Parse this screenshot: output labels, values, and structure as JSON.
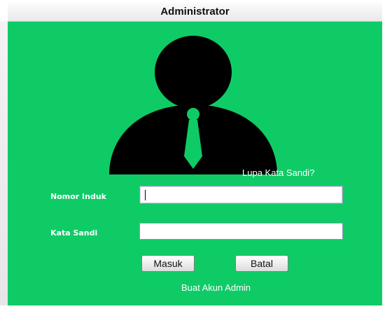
{
  "window": {
    "title": "Administrator"
  },
  "colors": {
    "panel_background": "#0fcb66",
    "text_on_panel": "#ffffff",
    "avatar": "#000000",
    "tie": "#0fcb66"
  },
  "avatar": {
    "icon": "user-admin-silhouette-icon"
  },
  "login": {
    "forgot_password_link": "Lupa Kata Sandi?",
    "id_label": "Nomor Induk",
    "id_value": "",
    "password_label": "Kata Sandi",
    "password_value": "",
    "login_button": "Masuk",
    "cancel_button": "Batal",
    "create_account_link": "Buat Akun Admin"
  }
}
